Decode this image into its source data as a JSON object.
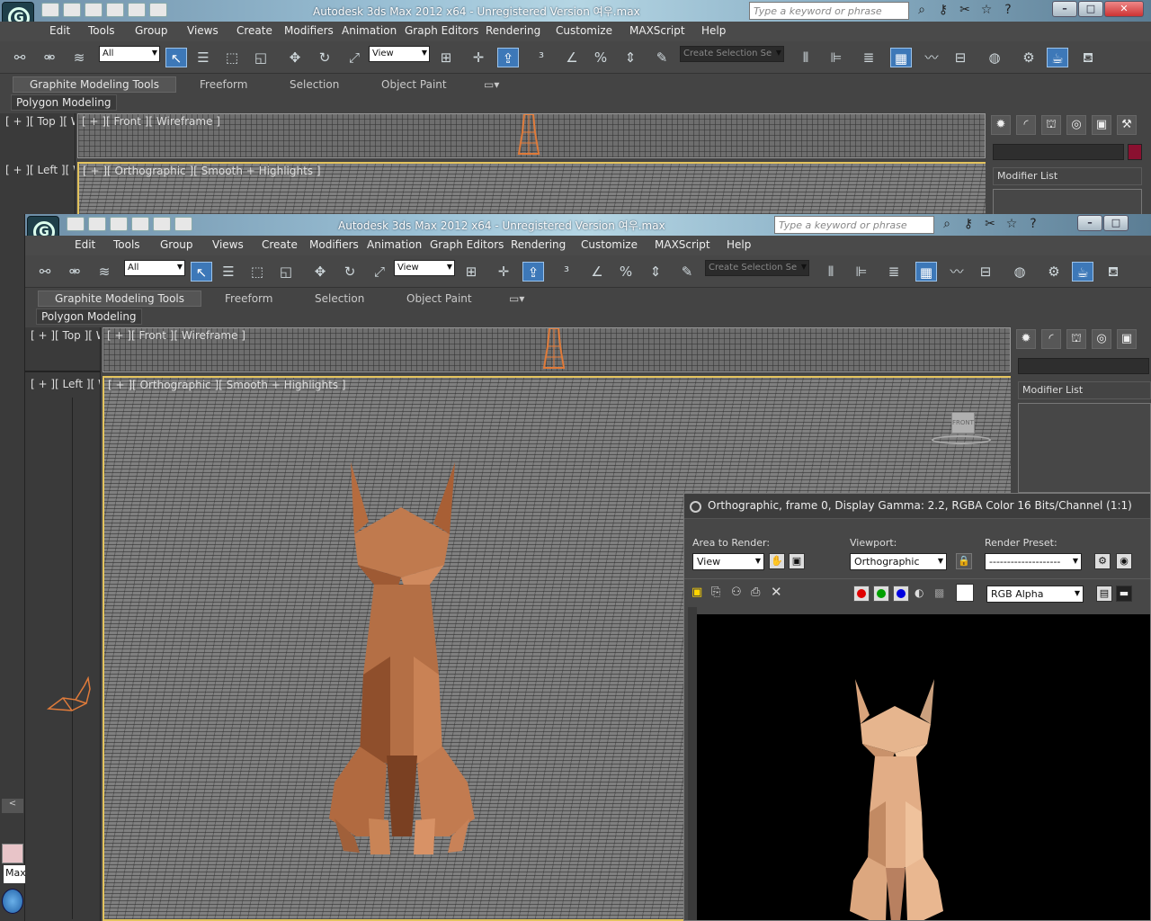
{
  "app": {
    "title": "Autodesk 3ds Max  2012 x64   - Unregistered Version    여우.max",
    "search_placeholder": "Type a keyword or phrase",
    "menu": [
      "Edit",
      "Tools",
      "Group",
      "Views",
      "Create",
      "Modifiers",
      "Animation",
      "Graph Editors",
      "Rendering",
      "Customize",
      "MAXScript",
      "Help"
    ],
    "selection_filter": "All",
    "ref_coord": "View",
    "named_selection": "Create Selection Se",
    "ribbon_tabs": [
      "Graphite Modeling Tools",
      "Freeform",
      "Selection",
      "Object Paint"
    ],
    "ribbon_panel": "Polygon Modeling",
    "viewports": {
      "top": "[ + ][ Top ][ W",
      "left": "[ + ][ Left ][ W",
      "front": "[ + ][ Front ][ Wireframe ]",
      "persp": "[ + ][ Orthographic ][ Smooth + Highlights ]"
    },
    "modifier_list": "Modifier List",
    "viewcube_label": "FRONT",
    "status_prefix": "Max"
  },
  "icons": [
    "select-link-icon",
    "unlink-icon",
    "bind-spacewarp-icon",
    "select-object-icon",
    "select-by-name-icon",
    "rect-region-icon",
    "window-crossing-icon",
    "move-icon",
    "rotate-icon",
    "scale-icon",
    "pivot-icon",
    "manipulate-icon",
    "snap-icon",
    "angle-snap-icon",
    "percent-snap-icon",
    "spinner-snap-icon",
    "edit-named-sel-icon",
    "mirror-icon",
    "align-icon",
    "layer-icon",
    "graphite-icon",
    "curve-editor-icon",
    "schematic-icon",
    "material-editor-icon",
    "render-setup-icon",
    "rendered-frame-icon",
    "render-icon"
  ],
  "render_window": {
    "title": "Orthographic, frame 0, Display Gamma: 2.2, RGBA Color 16 Bits/Channel (1:1)",
    "area_label": "Area to Render:",
    "area_value": "View",
    "viewport_label": "Viewport:",
    "viewport_value": "Orthographic",
    "preset_label": "Render Preset:",
    "preset_value": "--------------------",
    "channel_value": "RGB Alpha",
    "colors": {
      "red": "#e00000",
      "green": "#00a000",
      "blue": "#0000e0"
    }
  },
  "colors": {
    "accent": "#3d78b8",
    "viewport_border": "#e3c35e",
    "fox": "#c07a4e",
    "fox_render": "#e6b58e"
  }
}
